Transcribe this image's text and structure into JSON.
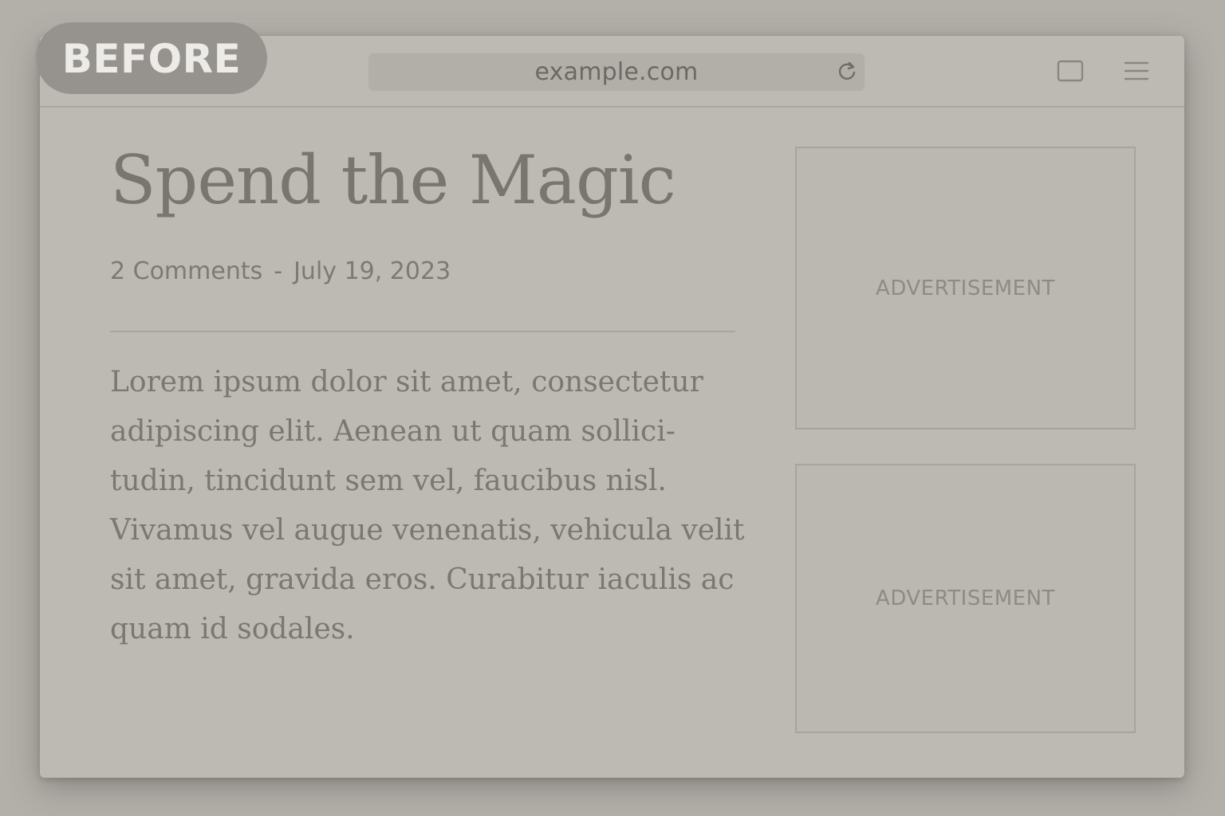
{
  "badge": {
    "label": "BEFORE"
  },
  "browser": {
    "url": "example.com",
    "icons": [
      "reload-icon",
      "tabs-icon",
      "menu-icon"
    ]
  },
  "article": {
    "title": "Spend the Magic",
    "comments": "2 Comments",
    "separator": "-",
    "date": "July 19, 2023",
    "body": "Lorem ipsum dolor sit amet, consectetur adipiscing elit. Aenean ut quam sollici-tudin, tincidunt sem vel, faucibus nisl. Vivamus vel augue venenatis, vehicula velit sit amet, gravida eros. Curabitur iaculis ac quam id sodales."
  },
  "sidebar": {
    "ads": [
      {
        "label": "ADVERTISEMENT"
      },
      {
        "label": "ADVERTISEMENT"
      }
    ]
  },
  "colors": {
    "background": "#b3b0aa",
    "window": "#bdbab4",
    "badge": "#96938e",
    "title_text": "#78766f"
  }
}
